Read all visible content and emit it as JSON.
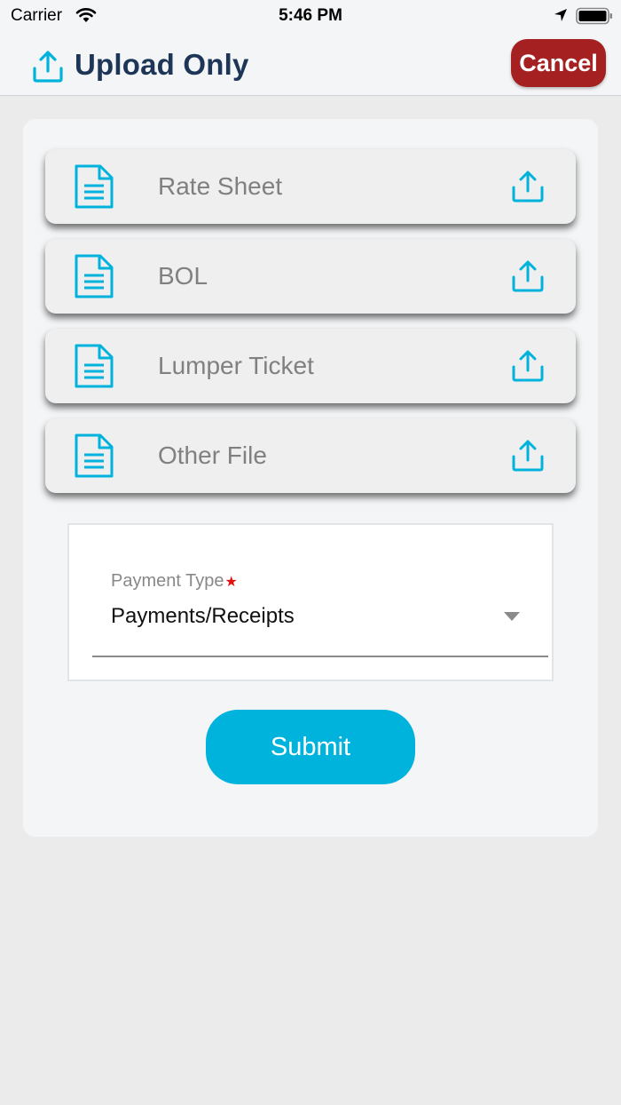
{
  "status_bar": {
    "carrier": "Carrier",
    "time": "5:46 PM"
  },
  "header": {
    "title": "Upload Only",
    "icon": "upload-icon",
    "cancel_label": "Cancel"
  },
  "files": [
    {
      "label": "Rate Sheet",
      "icon": "document-icon",
      "action_icon": "upload-icon"
    },
    {
      "label": "BOL",
      "icon": "document-icon",
      "action_icon": "upload-icon"
    },
    {
      "label": "Lumper Ticket",
      "icon": "document-icon",
      "action_icon": "upload-icon"
    },
    {
      "label": "Other File",
      "icon": "document-icon",
      "action_icon": "upload-icon"
    }
  ],
  "payment": {
    "label": "Payment Type",
    "required_mark": "★",
    "value": "Payments/Receipts"
  },
  "submit_label": "Submit",
  "colors": {
    "accent": "#00b3dd",
    "title": "#1d3557",
    "cancel": "#a52121",
    "required": "#e01010"
  }
}
